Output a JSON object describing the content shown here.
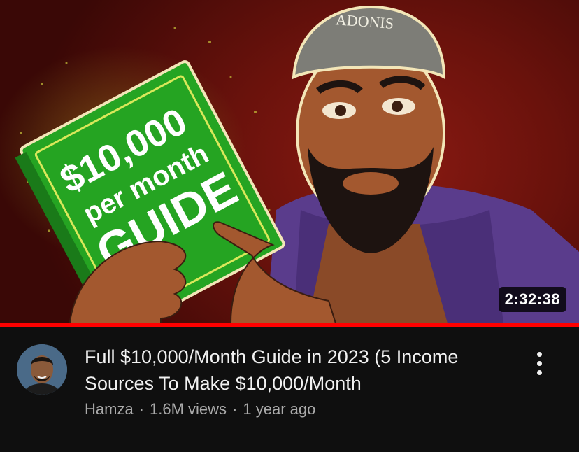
{
  "video": {
    "thumbnail": {
      "cap_text": "ADONIS",
      "book_line1": "$10,000",
      "book_line2": "per month",
      "book_line3": "GUIDE",
      "accent": "#2fa32a"
    },
    "duration": "2:32:38",
    "watch_progress": 1.0,
    "progress_color": "#ff0000",
    "title": "Full $10,000/Month Guide in 2023 (5 Income Sources To Make $10,000/Month",
    "channel": "Hamza",
    "separator": "·",
    "views": "1.6M views",
    "age": "1 year ago",
    "menu_icon": "more-vertical-icon"
  }
}
